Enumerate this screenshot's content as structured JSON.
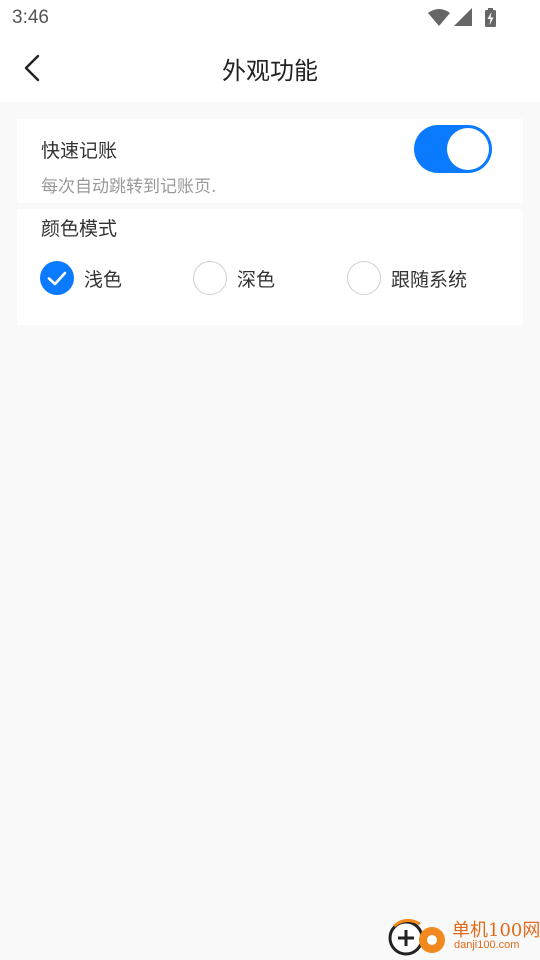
{
  "status_bar": {
    "time": "3:46",
    "icons": [
      "wifi-icon",
      "signal-icon",
      "battery-charging-icon"
    ]
  },
  "header": {
    "title": "外观功能",
    "back_icon": "chevron-left-icon"
  },
  "quick_entry": {
    "title": "快速记账",
    "description": "每次自动跳转到记账页.",
    "enabled": true
  },
  "color_mode": {
    "title": "颜色模式",
    "options": [
      {
        "label": "浅色",
        "selected": true
      },
      {
        "label": "深色",
        "selected": false
      },
      {
        "label": "跟随系统",
        "selected": false
      }
    ]
  },
  "watermark": {
    "name": "单机100网",
    "url": "danji100.com"
  },
  "colors": {
    "accent": "#0a7aff",
    "background": "#f9f9f9",
    "card": "#ffffff"
  }
}
